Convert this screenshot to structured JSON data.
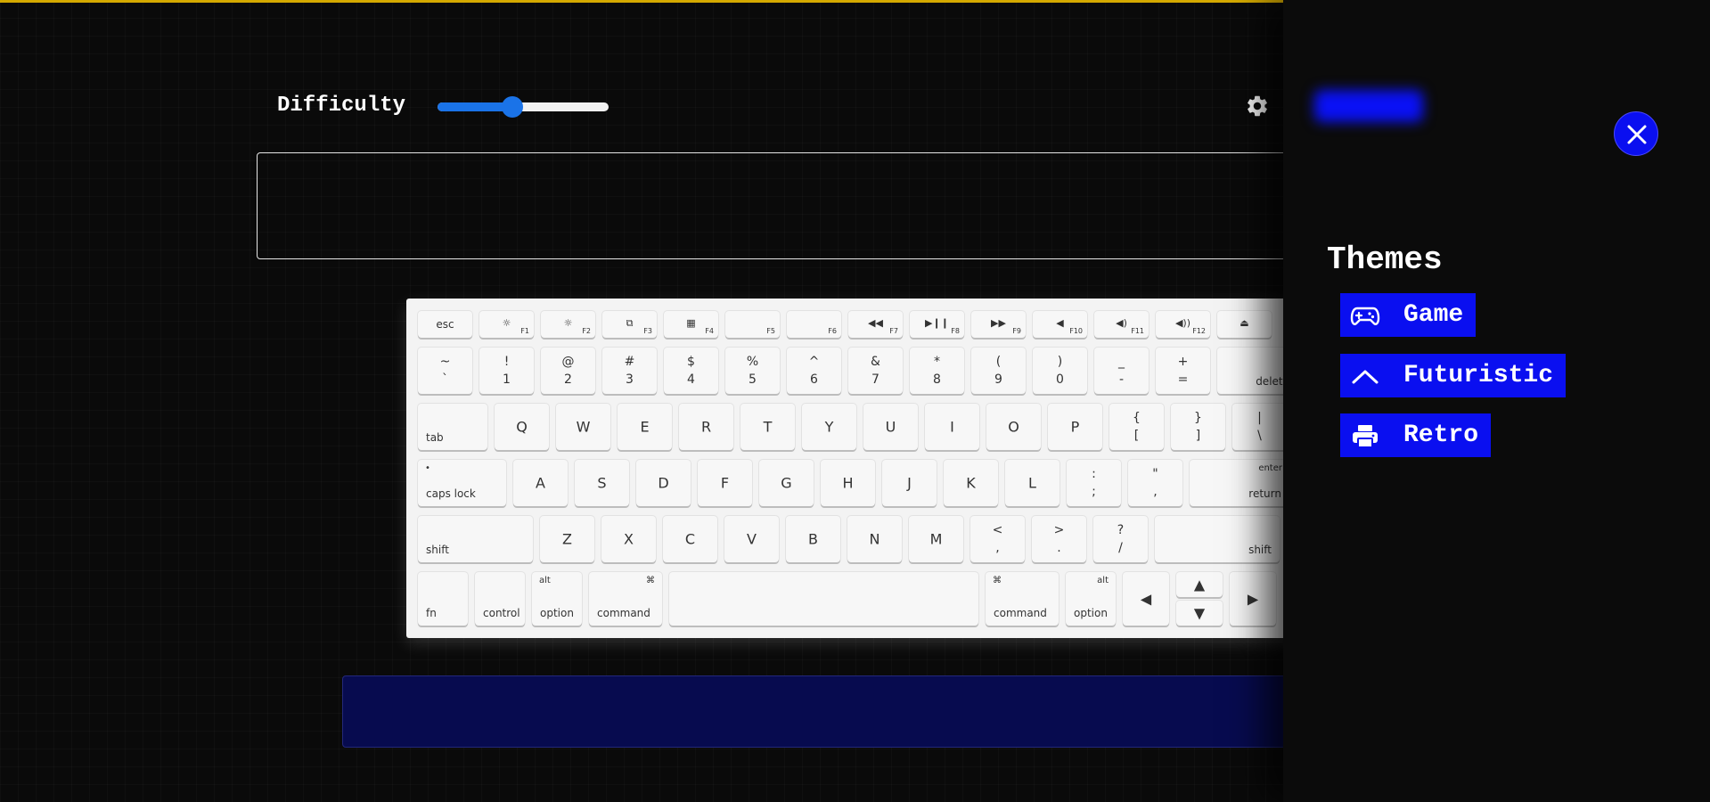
{
  "difficulty": {
    "label": "Difficulty",
    "value": 0.44
  },
  "themes": {
    "title": "Themes",
    "items": [
      {
        "label": "Game",
        "icon": "gamepad-icon"
      },
      {
        "label": "Futuristic",
        "icon": "chevron-up-icon"
      },
      {
        "label": "Retro",
        "icon": "printer-icon"
      }
    ]
  },
  "colors": {
    "accent": "#0a0ff0",
    "slider": "#1a73e8",
    "topbar": "#d4a900",
    "background": "#0a0a0a"
  },
  "keyboard": {
    "function_row": [
      {
        "main": "esc"
      },
      {
        "icon": "☼",
        "fn": "F1"
      },
      {
        "icon": "☼",
        "fn": "F2"
      },
      {
        "icon": "⧉",
        "fn": "F3"
      },
      {
        "icon": "▦",
        "fn": "F4"
      },
      {
        "fn": "F5"
      },
      {
        "fn": "F6"
      },
      {
        "icon": "◀◀",
        "fn": "F7"
      },
      {
        "icon": "▶❙❙",
        "fn": "F8"
      },
      {
        "icon": "▶▶",
        "fn": "F9"
      },
      {
        "icon": "◀",
        "fn": "F10"
      },
      {
        "icon": "◀)",
        "fn": "F11"
      },
      {
        "icon": "◀))",
        "fn": "F12"
      },
      {
        "icon": "⏏"
      }
    ],
    "number_row": [
      {
        "top": "~",
        "bottom": "`"
      },
      {
        "top": "!",
        "bottom": "1"
      },
      {
        "top": "@",
        "bottom": "2"
      },
      {
        "top": "#",
        "bottom": "3"
      },
      {
        "top": "$",
        "bottom": "4"
      },
      {
        "top": "%",
        "bottom": "5"
      },
      {
        "top": "^",
        "bottom": "6"
      },
      {
        "top": "&",
        "bottom": "7"
      },
      {
        "top": "*",
        "bottom": "8"
      },
      {
        "top": "(",
        "bottom": "9"
      },
      {
        "top": ")",
        "bottom": "0"
      },
      {
        "top": "_",
        "bottom": "-"
      },
      {
        "top": "+",
        "bottom": "="
      },
      {
        "br": "delete"
      }
    ],
    "q_row": [
      {
        "bl": "tab"
      },
      {
        "main": "Q"
      },
      {
        "main": "W"
      },
      {
        "main": "E"
      },
      {
        "main": "R"
      },
      {
        "main": "T"
      },
      {
        "main": "Y"
      },
      {
        "main": "U"
      },
      {
        "main": "I"
      },
      {
        "main": "O"
      },
      {
        "main": "P"
      },
      {
        "top": "{",
        "bottom": "["
      },
      {
        "top": "}",
        "bottom": "]"
      },
      {
        "top": "|",
        "bottom": "\\"
      }
    ],
    "a_row": [
      {
        "tl": "•",
        "bl": "caps lock"
      },
      {
        "main": "A"
      },
      {
        "main": "S"
      },
      {
        "main": "D"
      },
      {
        "main": "F"
      },
      {
        "main": "G"
      },
      {
        "main": "H"
      },
      {
        "main": "J"
      },
      {
        "main": "K"
      },
      {
        "main": "L"
      },
      {
        "top": ":",
        "bottom": ";"
      },
      {
        "top": "\"",
        "bottom": ","
      },
      {
        "tr": "enter",
        "br": "return"
      }
    ],
    "z_row": [
      {
        "bl": "shift"
      },
      {
        "main": "Z"
      },
      {
        "main": "X"
      },
      {
        "main": "C"
      },
      {
        "main": "V"
      },
      {
        "main": "B"
      },
      {
        "main": "N"
      },
      {
        "main": "M"
      },
      {
        "top": "<",
        "bottom": ","
      },
      {
        "top": ">",
        "bottom": "."
      },
      {
        "top": "?",
        "bottom": "/"
      },
      {
        "br": "shift"
      }
    ],
    "bottom_row": [
      {
        "bl": "fn"
      },
      {
        "bl": "control"
      },
      {
        "tl": "alt",
        "bl": "option"
      },
      {
        "tr": "⌘",
        "bl": "command"
      },
      {
        "main": ""
      },
      {
        "tl": "⌘",
        "bl": "command"
      },
      {
        "tr": "alt",
        "bl": "option"
      },
      {
        "main": "◀"
      },
      {
        "main": "▲"
      },
      {
        "main": "▼"
      },
      {
        "main": "▶"
      }
    ]
  }
}
